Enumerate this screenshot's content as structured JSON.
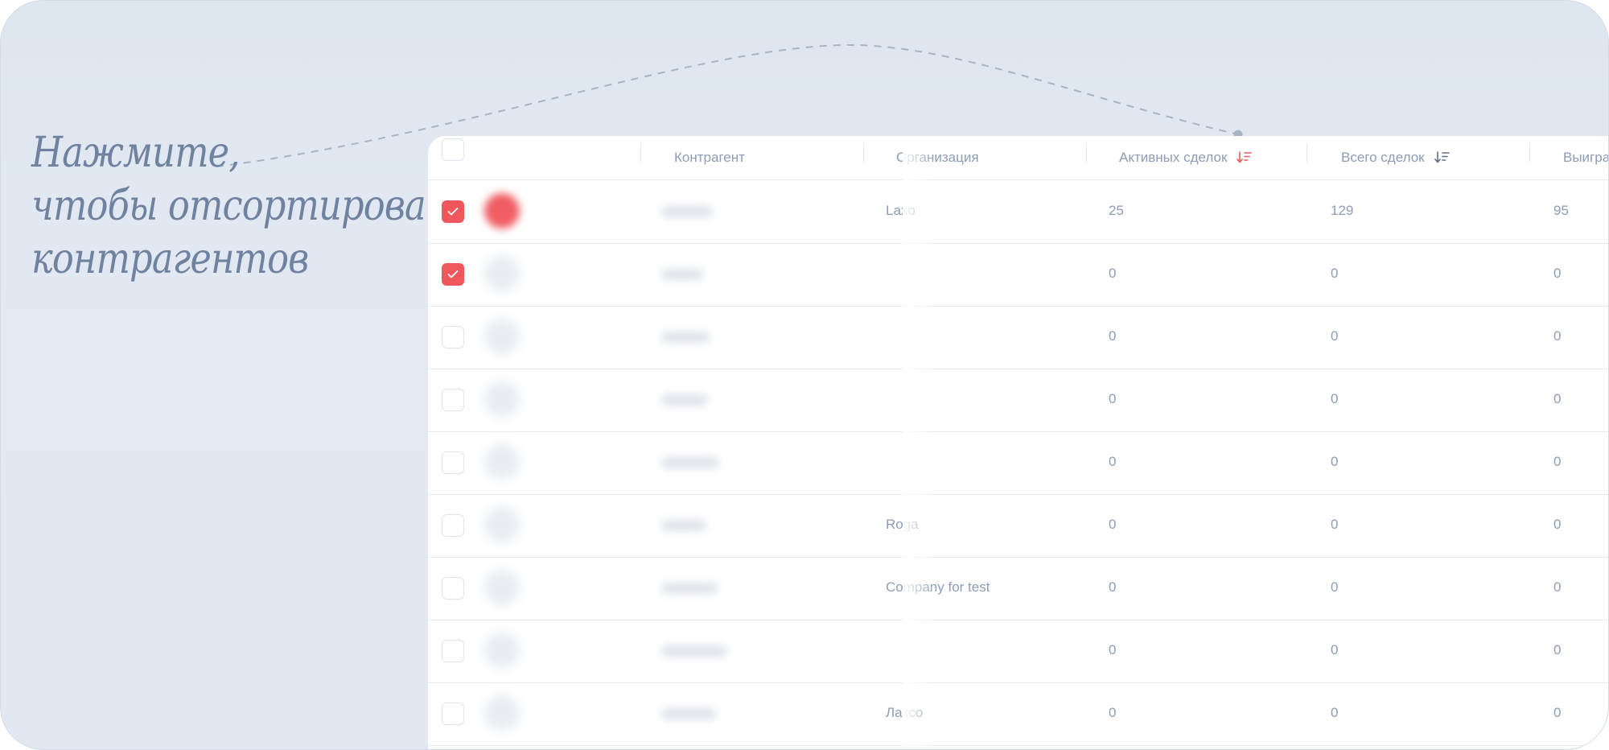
{
  "hint": {
    "lines": [
      "Нажмите,",
      "чтобы отсортировать",
      "контрагентов"
    ]
  },
  "table": {
    "columns": {
      "counterparty": "Контрагент",
      "organization": "Организация",
      "active_deals": "Активных сделок",
      "total_deals": "Всего сделок",
      "won": "Выигра"
    },
    "rows": [
      {
        "checked": true,
        "organization": "Laxo",
        "active": "25",
        "total": "129",
        "won": "95"
      },
      {
        "checked": true,
        "organization": "",
        "active": "0",
        "total": "0",
        "won": "0"
      },
      {
        "checked": false,
        "organization": "",
        "active": "0",
        "total": "0",
        "won": "0"
      },
      {
        "checked": false,
        "organization": "",
        "active": "0",
        "total": "0",
        "won": "0"
      },
      {
        "checked": false,
        "organization": "",
        "active": "0",
        "total": "0",
        "won": "0"
      },
      {
        "checked": false,
        "organization": "Roga",
        "active": "0",
        "total": "0",
        "won": "0"
      },
      {
        "checked": false,
        "organization": "Company for test",
        "active": "0",
        "total": "0",
        "won": "0"
      },
      {
        "checked": false,
        "organization": "",
        "active": "0",
        "total": "0",
        "won": "0"
      },
      {
        "checked": false,
        "organization": "Лаксо",
        "active": "0",
        "total": "0",
        "won": "0"
      }
    ]
  },
  "colors": {
    "accent": "#f0575d",
    "text_muted": "#8c9db5",
    "hint_text": "#6f83a0",
    "background": "#dee6f0"
  },
  "icons": {
    "active_sort": "sort-descending-icon",
    "total_sort": "sort-descending-icon",
    "checkbox_checked": "checkmark-icon"
  }
}
